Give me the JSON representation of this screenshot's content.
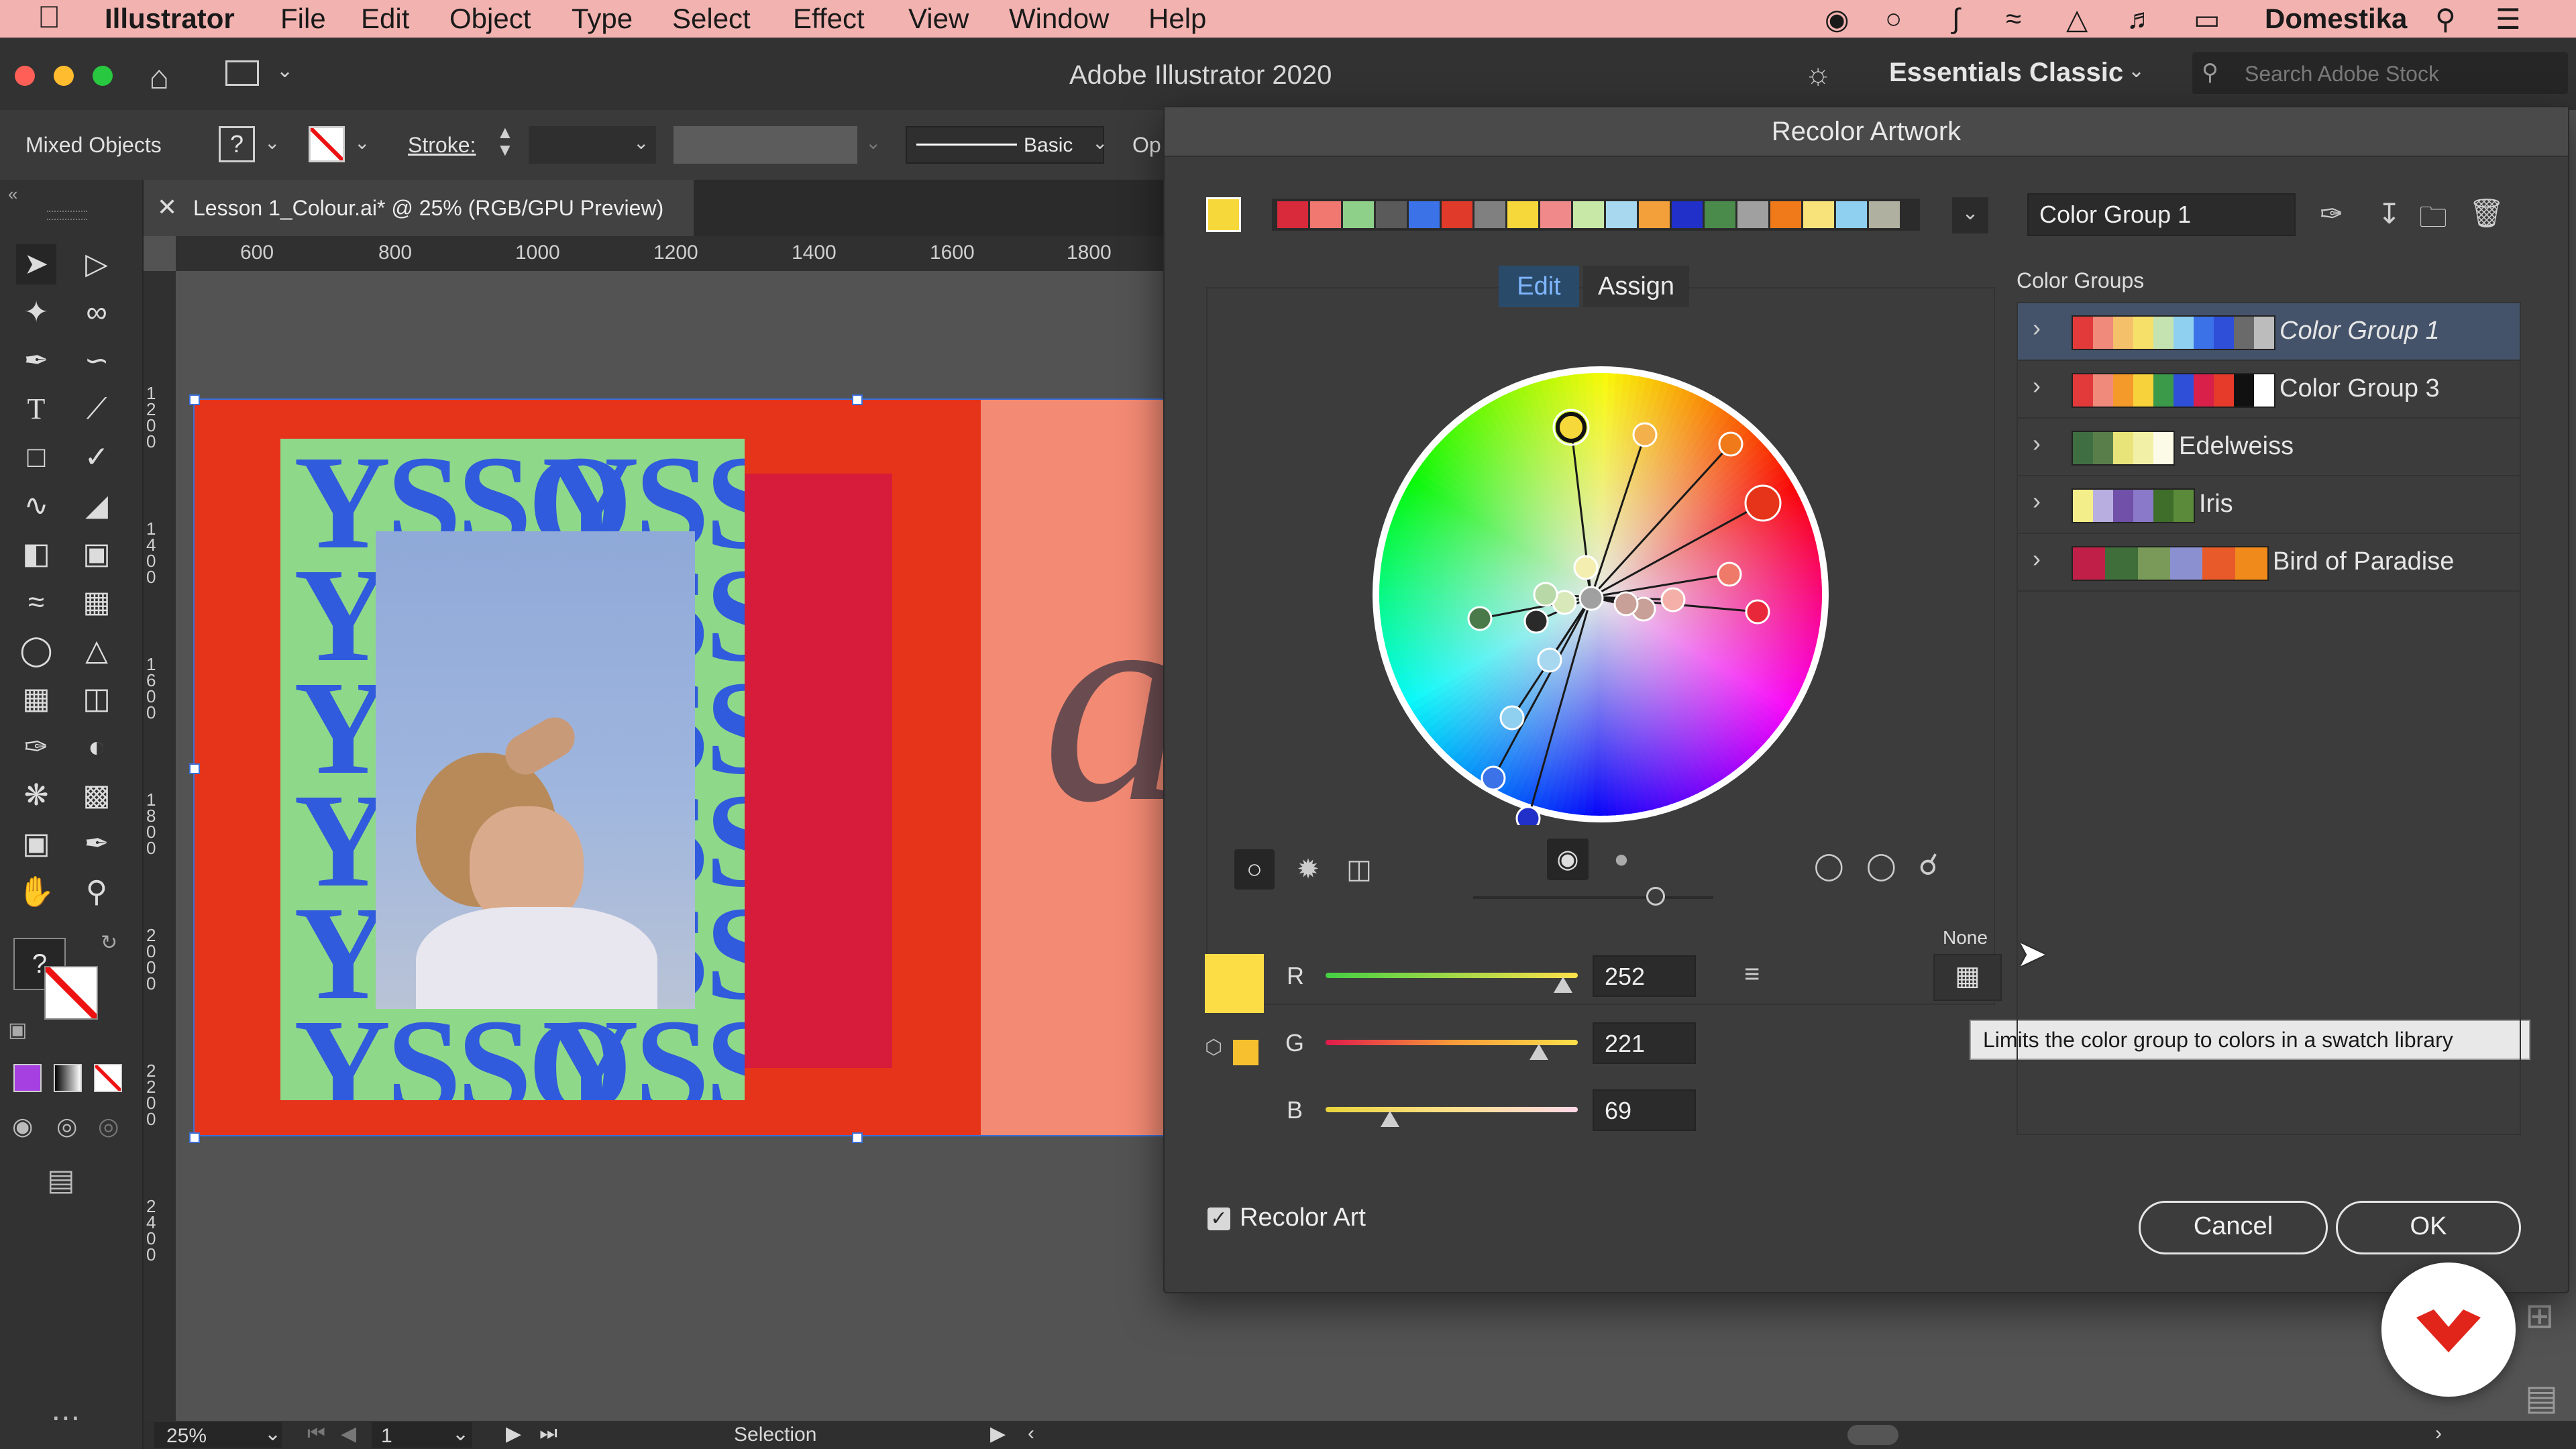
{
  "menubar": {
    "app_name": "Illustrator",
    "items": [
      "File",
      "Edit",
      "Object",
      "Type",
      "Select",
      "Effect",
      "View",
      "Window",
      "Help"
    ],
    "user": "Domestika"
  },
  "appbar": {
    "title": "Adobe Illustrator 2020",
    "workspace": "Essentials Classic",
    "search_placeholder": "Search Adobe Stock"
  },
  "controlbar": {
    "selection_label": "Mixed Objects",
    "stroke_label": "Stroke:",
    "brush_label": "Basic",
    "opacity_short": "Op"
  },
  "document": {
    "tab_title": "Lesson 1_Colour.ai* @ 25% (RGB/GPU Preview)",
    "ruler_h": [
      "600",
      "800",
      "1000",
      "1200",
      "1400",
      "1600",
      "1800"
    ],
    "ruler_v": [
      "1200",
      "1400",
      "1600",
      "1800",
      "2000",
      "2200",
      "2400"
    ],
    "poster_word": "YSSO",
    "artboard_letter": "a"
  },
  "statusbar": {
    "zoom": "25%",
    "page": "1",
    "tool": "Selection"
  },
  "dialog": {
    "title": "Recolor Artwork",
    "group_name": "Color Group 1",
    "tabs": {
      "edit": "Edit",
      "assign": "Assign"
    },
    "color_groups_label": "Color Groups",
    "color_groups": [
      {
        "name": "Color Group 1",
        "colors": [
          "#e23a3a",
          "#f08a7a",
          "#f4c16a",
          "#f7e06a",
          "#c4e3b0",
          "#8fd0f0",
          "#3b72e8",
          "#2f4fd8",
          "#6a6a6a",
          "#bcbcbc"
        ]
      },
      {
        "name": "Color Group 3",
        "colors": [
          "#e23a3a",
          "#f08a7a",
          "#f49a2a",
          "#f7d23a",
          "#3a9a4a",
          "#2f4fd8",
          "#d8204a",
          "#e63a2a",
          "#111111",
          "#ffffff"
        ]
      },
      {
        "name": "Edelweiss",
        "colors": [
          "#3f6e42",
          "#5a7e4a",
          "#e8e47a",
          "#f2f0a6",
          "#fbfbe8"
        ]
      },
      {
        "name": "Iris",
        "colors": [
          "#f4ee8a",
          "#b8aee0",
          "#7050a8",
          "#8a78c8",
          "#3e6e2a",
          "#5a8a3a"
        ]
      },
      {
        "name": "Bird of Paradise",
        "colors": [
          "#c02048",
          "#3f6e3a",
          "#7a9a5a",
          "#8a90d0",
          "#e85a2a",
          "#f08a1a"
        ]
      }
    ],
    "harmony_colors": [
      "#d82a3a",
      "#f07870",
      "#8ed08a",
      "#5a5a5a",
      "#3b72e8",
      "#e03a2a",
      "#808080",
      "#f7d83a",
      "#f08a8a",
      "#c8e8a8",
      "#a8d8f0",
      "#f4a03a",
      "#2030c8",
      "#4a8a4a",
      "#a0a0a0",
      "#f07a1a",
      "#f7e37a",
      "#8fd0f0",
      "#b0b0a0"
    ],
    "rgb": {
      "r_label": "R",
      "g_label": "G",
      "b_label": "B",
      "r": 252,
      "g": 221,
      "b": 69
    },
    "current_color": "#fcdd45",
    "none_label": "None",
    "tooltip": "Limits the color group to colors in a swatch library",
    "recolor_art_label": "Recolor Art",
    "recolor_art_checked": true,
    "cancel_label": "Cancel",
    "ok_label": "OK"
  },
  "colors": {
    "accent_red": "#e5341a",
    "poster_green": "#8ed88a",
    "poster_blue": "#2f5bdc",
    "selection_blue": "#3b6fd8",
    "domestika_red": "#e1251b"
  }
}
